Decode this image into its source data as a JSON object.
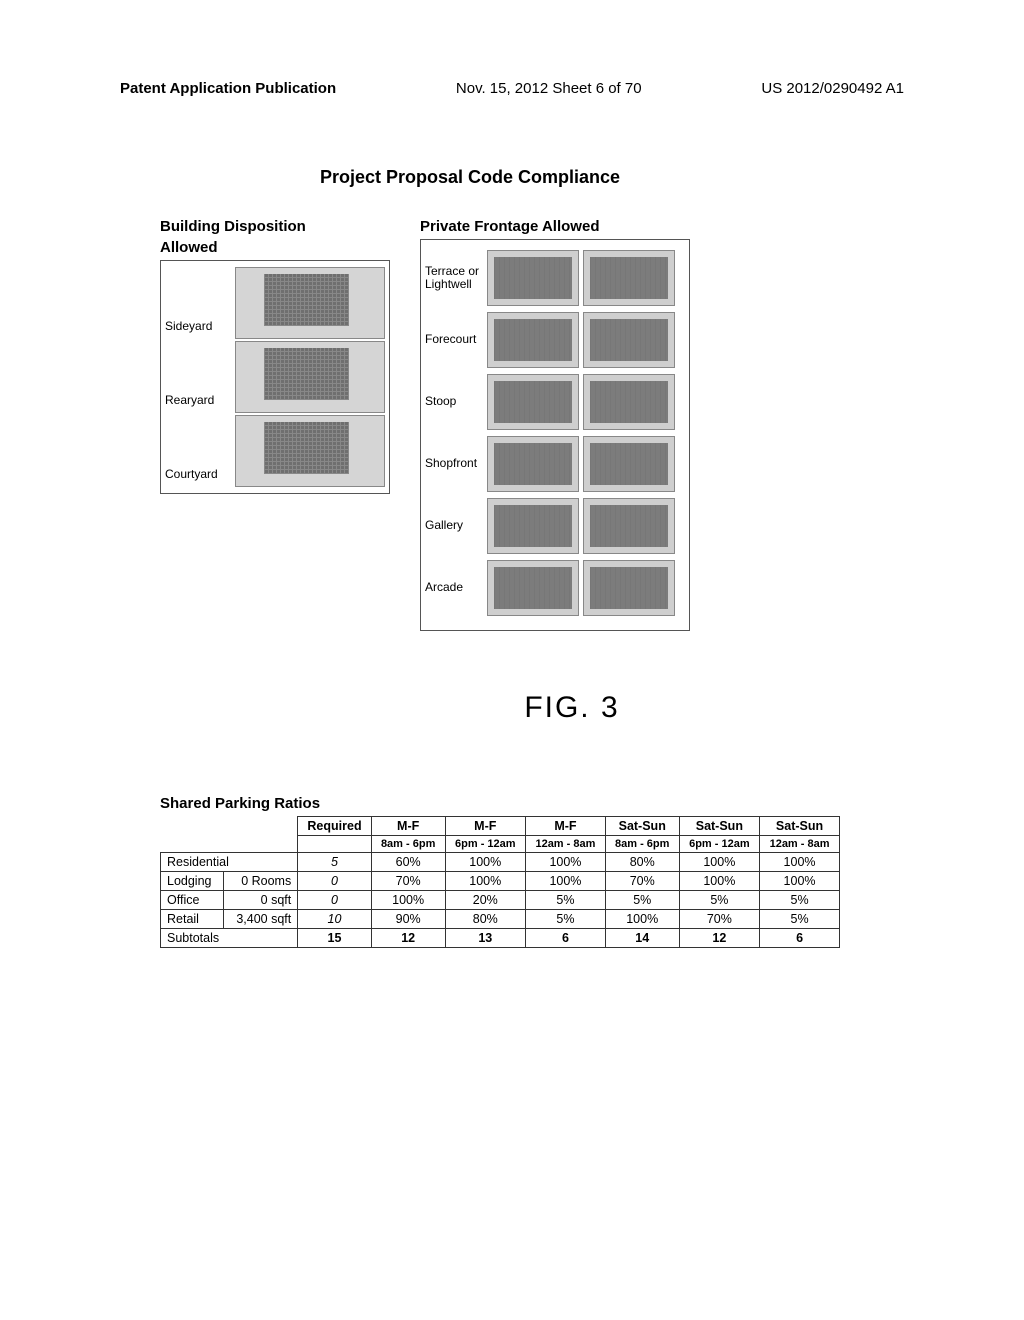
{
  "header": {
    "left": "Patent Application Publication",
    "center": "Nov. 15, 2012  Sheet 6 of 70",
    "right": "US 2012/0290492 A1"
  },
  "main_title": "Project Proposal Code Compliance",
  "disposition": {
    "title_line1": "Building Disposition",
    "title_line2": "Allowed",
    "items": [
      "Sideyard",
      "Rearyard",
      "Courtyard"
    ]
  },
  "frontage": {
    "title": "Private Frontage Allowed",
    "items": [
      "Terrace or Lightwell",
      "Forecourt",
      "Stoop",
      "Shopfront",
      "Gallery",
      "Arcade"
    ]
  },
  "figure_label": "FIG. 3",
  "parking_title": "Shared Parking Ratios",
  "chart_data": {
    "type": "table",
    "title": "Shared Parking Ratios",
    "header_groups": [
      {
        "label": "Required"
      },
      {
        "label": "M-F",
        "sub": "8am - 6pm"
      },
      {
        "label": "M-F",
        "sub": "6pm - 12am"
      },
      {
        "label": "M-F",
        "sub": "12am - 8am"
      },
      {
        "label": "Sat-Sun",
        "sub": "8am - 6pm"
      },
      {
        "label": "Sat-Sun",
        "sub": "6pm - 12am"
      },
      {
        "label": "Sat-Sun",
        "sub": "12am - 8am"
      }
    ],
    "rows": [
      {
        "name": "Residential",
        "qty": "",
        "required": 5,
        "values": [
          "60%",
          "100%",
          "100%",
          "80%",
          "100%",
          "100%"
        ]
      },
      {
        "name": "Lodging",
        "qty": "0 Rooms",
        "required": 0,
        "values": [
          "70%",
          "100%",
          "100%",
          "70%",
          "100%",
          "100%"
        ]
      },
      {
        "name": "Office",
        "qty": "0 sqft",
        "required": 0,
        "values": [
          "100%",
          "20%",
          "5%",
          "5%",
          "5%",
          "5%"
        ]
      },
      {
        "name": "Retail",
        "qty": "3,400 sqft",
        "required": 10,
        "values": [
          "90%",
          "80%",
          "5%",
          "100%",
          "70%",
          "5%"
        ]
      }
    ],
    "subtotals": {
      "name": "Subtotals",
      "required": 15,
      "values": [
        12,
        13,
        6,
        14,
        12,
        6
      ]
    }
  }
}
